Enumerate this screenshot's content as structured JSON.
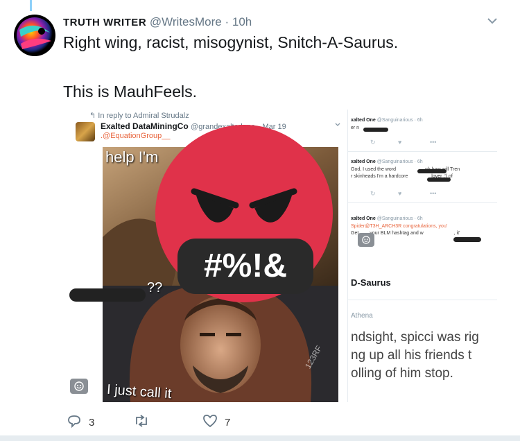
{
  "tweet": {
    "display_name": "TRUTH WRITER",
    "handle": "@WritesMore",
    "time": "10h",
    "line1": "Right wing, racist, misogynist, Snitch-A-Saurus.",
    "line2": "This is MauhFeels."
  },
  "embedded_left": {
    "reply_to": "In reply to Admiral Strudalz",
    "user_name": "Exalted DataMiningCo",
    "user_handle": "@grandexaltedone",
    "date": "Mar 19",
    "mention": ".@EquationGroup__",
    "meme_top": "help I'm",
    "meme_mid": "??",
    "meme_bottom": "I just call it",
    "watermark": "123RF",
    "emoji_text": "#%!&"
  },
  "embedded_right": {
    "r1_name": "xalted One",
    "r1_handle": "@Sanguinarious",
    "r1_time": "6h",
    "r1_text": "er n",
    "r2_name": "xalted One",
    "r2_handle": "@Sanguinarious",
    "r2_time": "6h",
    "r2_text_a": "God, I used the word",
    "r2_text_a2": "oh how will Tren",
    "r2_text_b": "r skinheads I'm a hardcore",
    "r2_text_b2": "lover :'( of",
    "r3_name": "xalted One",
    "r3_handle": "@Sanguinarious",
    "r3_time": "6h",
    "r3_text_a1": "Spider",
    "r3_text_a2": "@T3H_ARCH3R congratulations, you'",
    "r3_text_b1": "Get",
    "r3_text_b2": "your BLM hashtag and w",
    "r3_text_b3": ", it'",
    "title": "D-Saurus",
    "author": "Athena",
    "big1": "ndsight, spicci was rig",
    "big2": "ng up all his friends t",
    "big3": "olling of him stop."
  },
  "actions": {
    "reply_count": "3",
    "like_count": "7"
  },
  "colors": {
    "emoji_red": "#e0324a",
    "link_blue": "#1da1f2",
    "mention_orange": "#e8643c"
  },
  "icons": [
    "reply-icon",
    "retweet-icon",
    "like-icon",
    "chevron-down-icon",
    "smiley-icon"
  ]
}
